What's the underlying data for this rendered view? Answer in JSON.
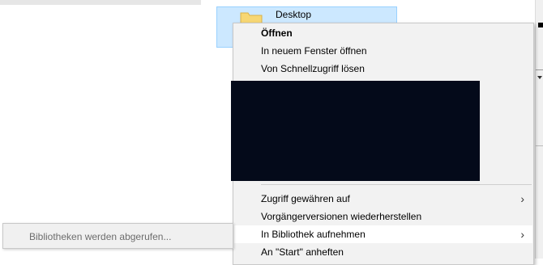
{
  "tile": {
    "label": "Desktop",
    "icon": "folder-icon"
  },
  "menu": {
    "items": [
      {
        "label": "Öffnen",
        "bold": true
      },
      {
        "label": "In neuem Fenster öffnen"
      },
      {
        "label": "Von Schnellzugriff lösen"
      },
      {
        "label": "Zugriff gewähren auf",
        "submenu": true
      },
      {
        "label": "Vorgängerversionen wiederherstellen"
      },
      {
        "label": "In Bibliothek aufnehmen",
        "submenu": true,
        "highlighted": true
      },
      {
        "label": "An \"Start\" anheften"
      }
    ],
    "submenu_glyph": "›"
  },
  "status": {
    "text": "Bibliotheken werden abgerufen..."
  },
  "colors": {
    "selection": "#cce8ff",
    "menu_bg": "#f2f2f2",
    "redaction": "#040a1a"
  }
}
